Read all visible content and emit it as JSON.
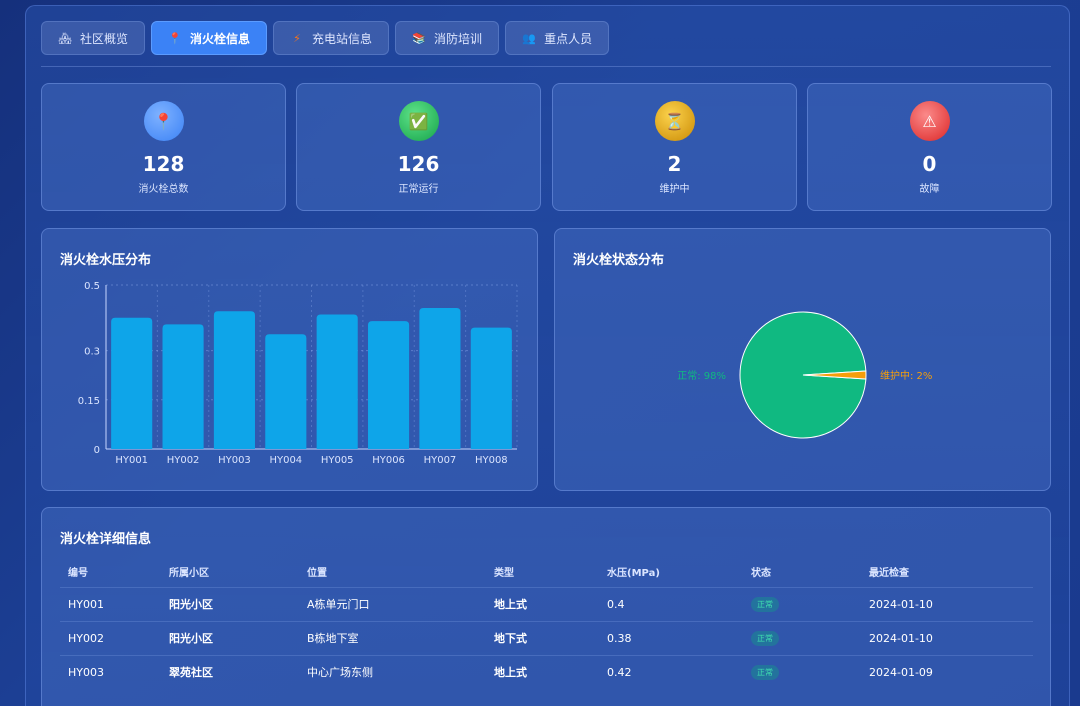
{
  "tabs": [
    {
      "label": "社区概览",
      "icon": "house-icon",
      "glyph": "🏘",
      "active": false
    },
    {
      "label": "消火栓信息",
      "icon": "pin-icon",
      "glyph": "📍",
      "active": true
    },
    {
      "label": "充电站信息",
      "icon": "lightning-icon",
      "glyph": "⚡",
      "active": false
    },
    {
      "label": "消防培训",
      "icon": "books-icon",
      "glyph": "📚",
      "active": false
    },
    {
      "label": "重点人员",
      "icon": "people-icon",
      "glyph": "👥",
      "active": false
    }
  ],
  "stats": [
    {
      "value": "128",
      "label": "消火栓总数",
      "icon": "pin-icon",
      "glyph": "📍",
      "color": "#3b82f6"
    },
    {
      "value": "126",
      "label": "正常运行",
      "icon": "check-icon",
      "glyph": "✅",
      "color": "#22c55e"
    },
    {
      "value": "2",
      "label": "维护中",
      "icon": "hourglass-icon",
      "glyph": "⏳",
      "color": "#eab308"
    },
    {
      "value": "0",
      "label": "故障",
      "icon": "warning-icon",
      "glyph": "⚠",
      "color": "#ef4444"
    }
  ],
  "pressure_panel": {
    "title": "消火栓水压分布"
  },
  "status_panel": {
    "title": "消火栓状态分布"
  },
  "chart_data": [
    {
      "type": "bar",
      "categories": [
        "HY001",
        "HY002",
        "HY003",
        "HY004",
        "HY005",
        "HY006",
        "HY007",
        "HY008"
      ],
      "values": [
        0.4,
        0.38,
        0.42,
        0.35,
        0.41,
        0.39,
        0.43,
        0.37
      ],
      "ylim": [
        0,
        0.5
      ],
      "yticks": [
        "0",
        "0.15",
        "0.3",
        "0.5"
      ],
      "grid": true,
      "color": "#0ea5e9"
    },
    {
      "type": "pie",
      "slices": [
        {
          "label": "正常",
          "percent": "98%",
          "value": 98,
          "color": "#10b981"
        },
        {
          "label": "维护中",
          "percent": "2%",
          "value": 2,
          "color": "#f59e0b"
        }
      ]
    }
  ],
  "table": {
    "title": "消火栓详细信息",
    "headers": [
      "编号",
      "所属小区",
      "位置",
      "类型",
      "水压(MPa)",
      "状态",
      "最近检查"
    ],
    "rows": [
      [
        "HY001",
        "阳光小区",
        "A栋单元门口",
        "地上式",
        "0.4",
        "正常",
        "2024-01-10"
      ],
      [
        "HY002",
        "阳光小区",
        "B栋地下室",
        "地下式",
        "0.38",
        "正常",
        "2024-01-10"
      ],
      [
        "HY003",
        "翠苑社区",
        "中心广场东侧",
        "地上式",
        "0.42",
        "正常",
        "2024-01-09"
      ]
    ]
  }
}
